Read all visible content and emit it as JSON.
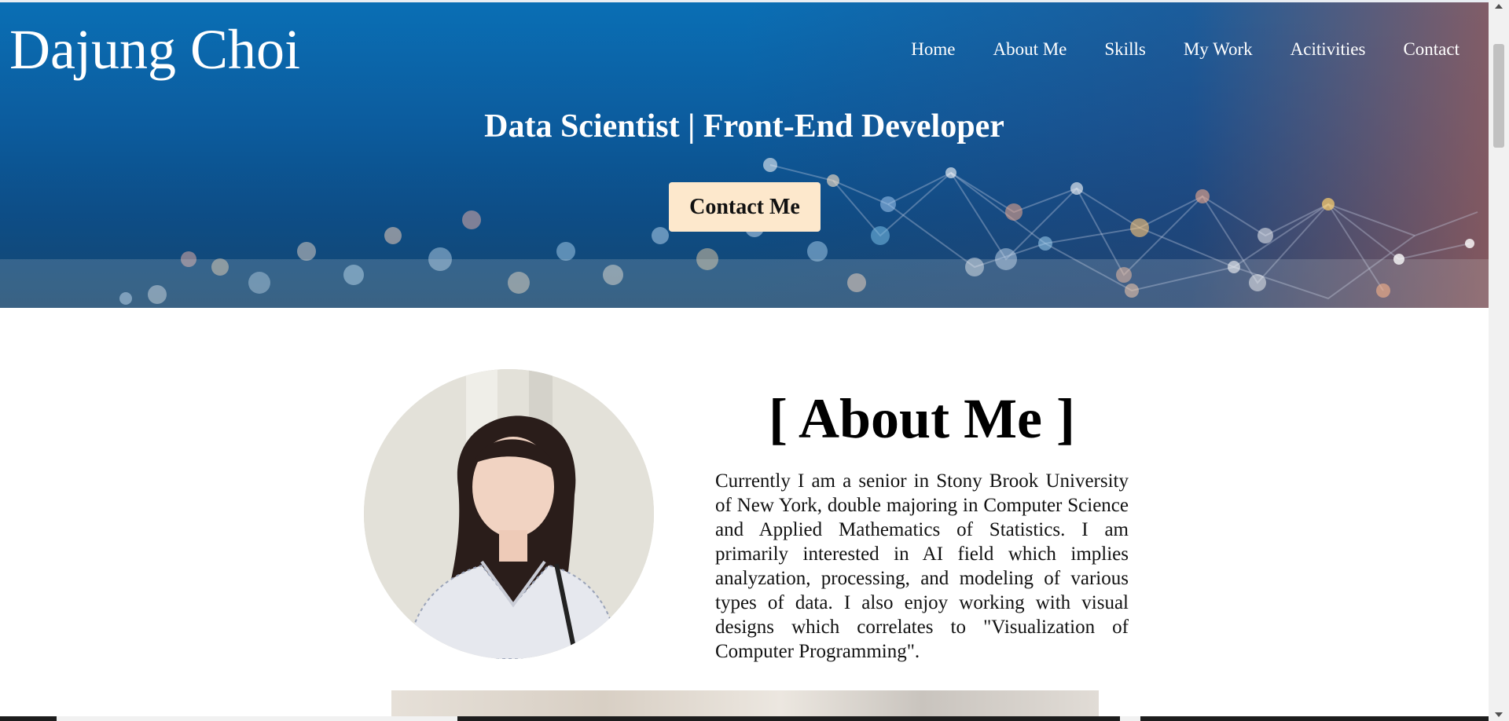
{
  "header": {
    "brand": "Dajung Choi",
    "nav": [
      "Home",
      "About Me",
      "Skills",
      "My Work",
      "Acitivities",
      "Contact"
    ],
    "tagline": "Data Scientist | Front-End Developer",
    "contact_button": "Contact Me"
  },
  "about": {
    "title": "[ About Me ]",
    "text": "Currently I am a senior in Stony Brook University of New York, double majoring in Computer Science and Applied Mathematics of Statistics. I am primarily interested in AI field which implies analyzation, processing, and modeling of various types of data. I also enjoy working with visual designs which correlates to \"Visualization of Computer Programming\"."
  },
  "colors": {
    "hero_blue": "#0c5c9e",
    "hero_accent": "#965a5a",
    "button_bg": "#fde8cc",
    "text": "#111111"
  },
  "icons": [
    "scroll-up-arrow-icon",
    "scroll-down-arrow-icon"
  ]
}
